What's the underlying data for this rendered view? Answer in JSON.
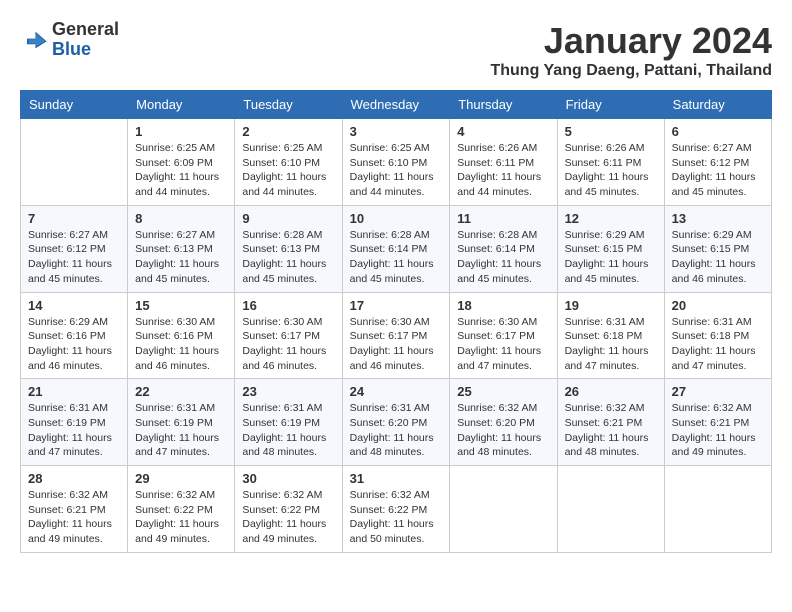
{
  "header": {
    "logo_general": "General",
    "logo_blue": "Blue",
    "month_title": "January 2024",
    "location": "Thung Yang Daeng, Pattani, Thailand"
  },
  "days_of_week": [
    "Sunday",
    "Monday",
    "Tuesday",
    "Wednesday",
    "Thursday",
    "Friday",
    "Saturday"
  ],
  "weeks": [
    [
      {
        "day": "",
        "info": ""
      },
      {
        "day": "1",
        "info": "Sunrise: 6:25 AM\nSunset: 6:09 PM\nDaylight: 11 hours\nand 44 minutes."
      },
      {
        "day": "2",
        "info": "Sunrise: 6:25 AM\nSunset: 6:10 PM\nDaylight: 11 hours\nand 44 minutes."
      },
      {
        "day": "3",
        "info": "Sunrise: 6:25 AM\nSunset: 6:10 PM\nDaylight: 11 hours\nand 44 minutes."
      },
      {
        "day": "4",
        "info": "Sunrise: 6:26 AM\nSunset: 6:11 PM\nDaylight: 11 hours\nand 44 minutes."
      },
      {
        "day": "5",
        "info": "Sunrise: 6:26 AM\nSunset: 6:11 PM\nDaylight: 11 hours\nand 45 minutes."
      },
      {
        "day": "6",
        "info": "Sunrise: 6:27 AM\nSunset: 6:12 PM\nDaylight: 11 hours\nand 45 minutes."
      }
    ],
    [
      {
        "day": "7",
        "info": "Sunrise: 6:27 AM\nSunset: 6:12 PM\nDaylight: 11 hours\nand 45 minutes."
      },
      {
        "day": "8",
        "info": "Sunrise: 6:27 AM\nSunset: 6:13 PM\nDaylight: 11 hours\nand 45 minutes."
      },
      {
        "day": "9",
        "info": "Sunrise: 6:28 AM\nSunset: 6:13 PM\nDaylight: 11 hours\nand 45 minutes."
      },
      {
        "day": "10",
        "info": "Sunrise: 6:28 AM\nSunset: 6:14 PM\nDaylight: 11 hours\nand 45 minutes."
      },
      {
        "day": "11",
        "info": "Sunrise: 6:28 AM\nSunset: 6:14 PM\nDaylight: 11 hours\nand 45 minutes."
      },
      {
        "day": "12",
        "info": "Sunrise: 6:29 AM\nSunset: 6:15 PM\nDaylight: 11 hours\nand 45 minutes."
      },
      {
        "day": "13",
        "info": "Sunrise: 6:29 AM\nSunset: 6:15 PM\nDaylight: 11 hours\nand 46 minutes."
      }
    ],
    [
      {
        "day": "14",
        "info": "Sunrise: 6:29 AM\nSunset: 6:16 PM\nDaylight: 11 hours\nand 46 minutes."
      },
      {
        "day": "15",
        "info": "Sunrise: 6:30 AM\nSunset: 6:16 PM\nDaylight: 11 hours\nand 46 minutes."
      },
      {
        "day": "16",
        "info": "Sunrise: 6:30 AM\nSunset: 6:17 PM\nDaylight: 11 hours\nand 46 minutes."
      },
      {
        "day": "17",
        "info": "Sunrise: 6:30 AM\nSunset: 6:17 PM\nDaylight: 11 hours\nand 46 minutes."
      },
      {
        "day": "18",
        "info": "Sunrise: 6:30 AM\nSunset: 6:17 PM\nDaylight: 11 hours\nand 47 minutes."
      },
      {
        "day": "19",
        "info": "Sunrise: 6:31 AM\nSunset: 6:18 PM\nDaylight: 11 hours\nand 47 minutes."
      },
      {
        "day": "20",
        "info": "Sunrise: 6:31 AM\nSunset: 6:18 PM\nDaylight: 11 hours\nand 47 minutes."
      }
    ],
    [
      {
        "day": "21",
        "info": "Sunrise: 6:31 AM\nSunset: 6:19 PM\nDaylight: 11 hours\nand 47 minutes."
      },
      {
        "day": "22",
        "info": "Sunrise: 6:31 AM\nSunset: 6:19 PM\nDaylight: 11 hours\nand 47 minutes."
      },
      {
        "day": "23",
        "info": "Sunrise: 6:31 AM\nSunset: 6:19 PM\nDaylight: 11 hours\nand 48 minutes."
      },
      {
        "day": "24",
        "info": "Sunrise: 6:31 AM\nSunset: 6:20 PM\nDaylight: 11 hours\nand 48 minutes."
      },
      {
        "day": "25",
        "info": "Sunrise: 6:32 AM\nSunset: 6:20 PM\nDaylight: 11 hours\nand 48 minutes."
      },
      {
        "day": "26",
        "info": "Sunrise: 6:32 AM\nSunset: 6:21 PM\nDaylight: 11 hours\nand 48 minutes."
      },
      {
        "day": "27",
        "info": "Sunrise: 6:32 AM\nSunset: 6:21 PM\nDaylight: 11 hours\nand 49 minutes."
      }
    ],
    [
      {
        "day": "28",
        "info": "Sunrise: 6:32 AM\nSunset: 6:21 PM\nDaylight: 11 hours\nand 49 minutes."
      },
      {
        "day": "29",
        "info": "Sunrise: 6:32 AM\nSunset: 6:22 PM\nDaylight: 11 hours\nand 49 minutes."
      },
      {
        "day": "30",
        "info": "Sunrise: 6:32 AM\nSunset: 6:22 PM\nDaylight: 11 hours\nand 49 minutes."
      },
      {
        "day": "31",
        "info": "Sunrise: 6:32 AM\nSunset: 6:22 PM\nDaylight: 11 hours\nand 50 minutes."
      },
      {
        "day": "",
        "info": ""
      },
      {
        "day": "",
        "info": ""
      },
      {
        "day": "",
        "info": ""
      }
    ]
  ]
}
